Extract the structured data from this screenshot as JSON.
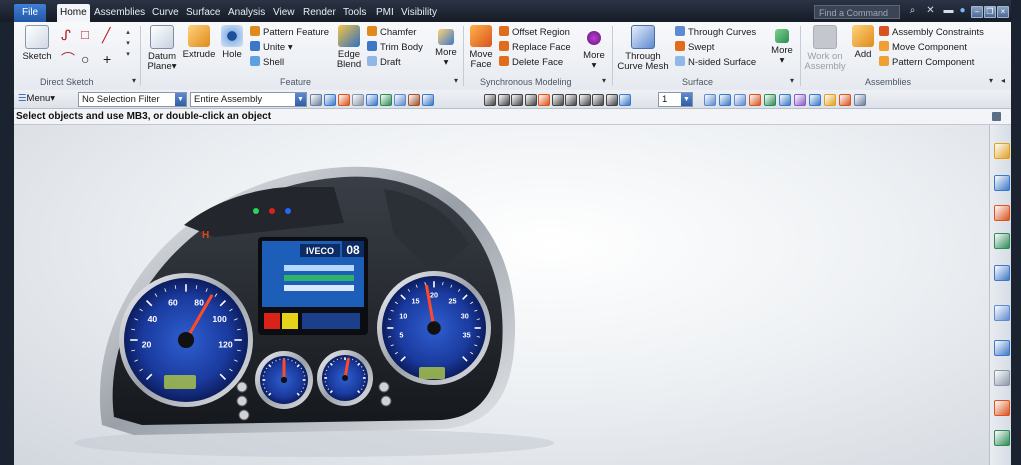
{
  "menu_tabs": {
    "file": "File",
    "home": "Home",
    "assemblies": "Assemblies",
    "curve": "Curve",
    "surface": "Surface",
    "analysis": "Analysis",
    "view": "View",
    "render": "Render",
    "tools": "Tools",
    "pmi": "PMI",
    "visibility": "Visibility"
  },
  "search": {
    "placeholder": "Find a Command"
  },
  "ribbon": {
    "direct_sketch": {
      "label": "Direct Sketch",
      "sketch": "Sketch"
    },
    "feature": {
      "label": "Feature",
      "datum_plane_1": "Datum",
      "datum_plane_2": "Plane▾",
      "extrude": "Extrude",
      "hole": "Hole",
      "pattern_feature": "Pattern Feature",
      "unite": "Unite ▾",
      "shell": "Shell",
      "edge_blend_1": "Edge",
      "edge_blend_2": "Blend",
      "chamfer": "Chamfer",
      "trim_body": "Trim Body",
      "draft": "Draft",
      "more": "More"
    },
    "synchronous_modeling": {
      "label": "Synchronous Modeling",
      "move_face_1": "Move",
      "move_face_2": "Face",
      "offset_region": "Offset Region",
      "replace_face": "Replace Face",
      "delete_face": "Delete Face",
      "more": "More"
    },
    "surface": {
      "label": "Surface",
      "through_curve_mesh_1": "Through",
      "through_curve_mesh_2": "Curve Mesh",
      "through_curves": "Through Curves",
      "swept": "Swept",
      "n_sided_surface": "N-sided Surface",
      "more": "More"
    },
    "assemblies": {
      "label": "Assemblies",
      "work_on_assembly_1": "Work on",
      "work_on_assembly_2": "Assembly",
      "add": "Add",
      "assembly_constraints": "Assembly Constraints",
      "move_component": "Move Component",
      "pattern_component": "Pattern Component"
    }
  },
  "toolbar": {
    "menu": "Menu▾",
    "selection_filter": "No Selection Filter",
    "selection_scope": "Entire Assembly",
    "layer_value": "1",
    "icons": [
      "snap-icon",
      "filter-icon",
      "select-rectangle-icon",
      "select-lasso-icon",
      "select-box-icon",
      "select-all-icon",
      "view-icon",
      "shade-icon",
      "fit-icon",
      "snap-endpoint-icon",
      "snap-midpoint-icon",
      "snap-line-icon",
      "snap-arc-icon",
      "snap-center-icon",
      "snap-point-icon",
      "snap-intersection-icon",
      "snap-tangent-icon",
      "snap-quadrant-icon",
      "snap-grid-icon",
      "snap-pole-icon",
      "orient-icon",
      "layer-icon",
      "render-style-icon",
      "clip-icon",
      "measure-icon",
      "analysis-icon",
      "material-icon",
      "camera-icon",
      "light-icon",
      "color-icon",
      "settings-icon"
    ]
  },
  "status": {
    "prompt": "Select objects and use MB3, or double-click an object"
  },
  "resource_bar": {
    "icons": [
      "assembly-navigator-icon",
      "constraint-navigator-icon",
      "part-navigator-icon",
      "reuse-library-icon",
      "hd3d-tools-icon",
      "web-browser-icon",
      "history-icon",
      "process-studio-icon",
      "roles-icon",
      "system-materials-icon"
    ]
  },
  "dashboard_render": {
    "brand": "IVECO",
    "odometer": "08",
    "speedometer_labels": [
      "20",
      "40",
      "60",
      "80",
      "100",
      "120"
    ],
    "tachometer_labels": [
      "5",
      "10",
      "15",
      "20",
      "25",
      "30",
      "35"
    ]
  },
  "colors": {
    "accent": "#2a64b8",
    "gauge_face": "#1c3fa8",
    "needle": "#ff4a2a"
  }
}
